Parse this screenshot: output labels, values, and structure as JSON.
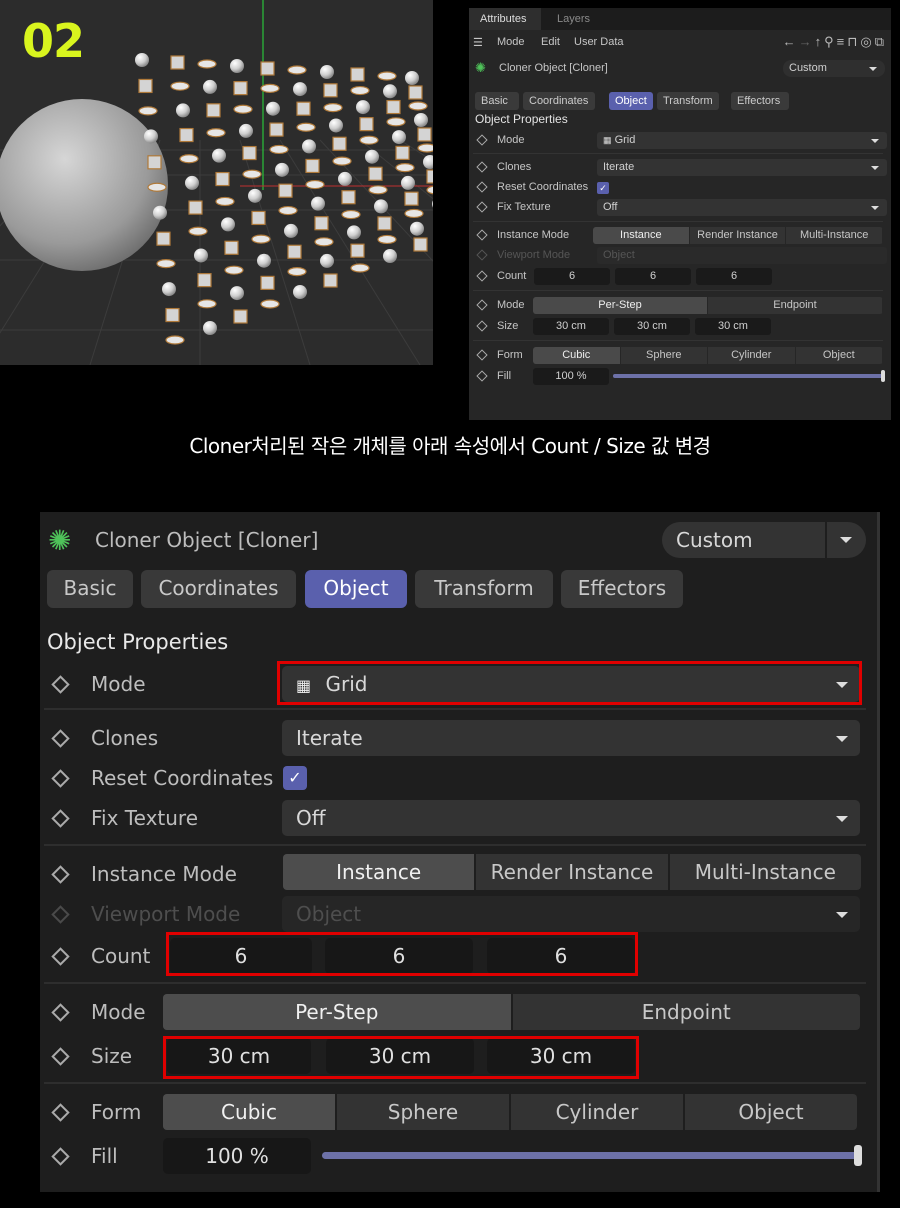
{
  "step_number": "02",
  "caption": "Cloner처리된 작은 개체를 아래 속성에서 Count / Size 값 변경",
  "colors": {
    "accent_tab": "#5a60ad",
    "highlight": "#e00000",
    "step_label": "#d9f51e"
  },
  "panel_tabs": {
    "attributes": "Attributes",
    "layers": "Layers"
  },
  "menu": {
    "mode": "Mode",
    "edit": "Edit",
    "user_data": "User Data"
  },
  "toolbar_icons": [
    "back-arrow-icon",
    "forward-arrow-icon",
    "up-arrow-icon",
    "search-icon",
    "filter-icon",
    "lock-icon",
    "target-icon",
    "open-external-icon"
  ],
  "object": {
    "title": "Cloner Object [Cloner]",
    "preset": "Custom",
    "icon": "cloner-icon"
  },
  "tabs": [
    "Basic",
    "Coordinates",
    "Object",
    "Transform",
    "Effectors"
  ],
  "active_tab": "Object",
  "section_title": "Object Properties",
  "props": {
    "mode_label": "Mode",
    "mode_value": "Grid",
    "clones_label": "Clones",
    "clones_value": "Iterate",
    "reset_label": "Reset Coordinates",
    "reset_checked": true,
    "fix_texture_label": "Fix Texture",
    "fix_texture_value": "Off",
    "instance_mode_label": "Instance Mode",
    "instance_modes": [
      "Instance",
      "Render Instance",
      "Multi-Instance"
    ],
    "viewport_mode_label": "Viewport Mode",
    "viewport_mode_value": "Object",
    "count_label": "Count",
    "count_values": [
      "6",
      "6",
      "6"
    ],
    "step_mode_label": "Mode",
    "step_modes": [
      "Per-Step",
      "Endpoint"
    ],
    "size_label": "Size",
    "size_values": [
      "30 cm",
      "30 cm",
      "30 cm"
    ],
    "form_label": "Form",
    "forms": [
      "Cubic",
      "Sphere",
      "Cylinder",
      "Object"
    ],
    "fill_label": "Fill",
    "fill_value": "100 %",
    "fill_fraction": 1.0
  }
}
